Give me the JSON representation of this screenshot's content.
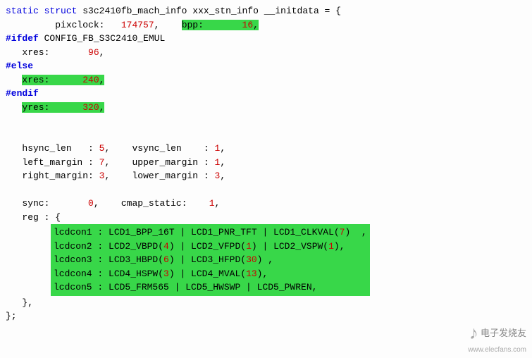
{
  "decl": {
    "static": "static",
    "struct": "struct",
    "type": "s3c2410fb_mach_info",
    "varname": "xxx_stn_info",
    "initdata": "__initdata",
    "eq": " = {"
  },
  "pixclock": {
    "label": "pixclock:",
    "value": "174757",
    "comma": ","
  },
  "bpp": {
    "label": "bpp:",
    "value": "16",
    "comma": ","
  },
  "ifdef": "#ifdef",
  "ifdef_sym": "CONFIG_FB_S3C2410_EMUL",
  "xres1": {
    "label": "xres:",
    "value": "96",
    "comma": ","
  },
  "else": "#else",
  "xres2": {
    "label": "xres:",
    "value": "240",
    "comma": ","
  },
  "endif": "#endif",
  "yres": {
    "label": "yres:",
    "value": "320",
    "comma": ","
  },
  "hsync": {
    "label": "hsync_len   : ",
    "value": "5",
    "comma": ","
  },
  "vsync": {
    "label": "vsync_len    : ",
    "value": "1",
    "comma": ","
  },
  "lmargin": {
    "label": "left_margin : ",
    "value": "7",
    "comma": ","
  },
  "umargin": {
    "label": "upper_margin : ",
    "value": "1",
    "comma": ","
  },
  "rmargin": {
    "label": "right_margin: ",
    "value": "3",
    "comma": ","
  },
  "lomargin": {
    "label": "lower_margin : ",
    "value": "3",
    "comma": ","
  },
  "sync": {
    "label": "sync:       ",
    "value": "0",
    "comma": ","
  },
  "cmap": {
    "label": "cmap_static:    ",
    "value": "1",
    "comma": ","
  },
  "reg": {
    "label": "reg : {"
  },
  "lcdcon1": {
    "label": "lcdcon1 : LCD1_BPP_16T | LCD1_PNR_TFT | LCD1_CLKVAL(",
    "v": "7",
    "rest": ")  ,"
  },
  "lcdcon2": {
    "label": "lcdcon2 : LCD2_VBPD(",
    "v1": "4",
    "mid1": ") | LCD2_VFPD(",
    "v2": "1",
    "mid2": ") | LCD2_VSPW(",
    "v3": "1",
    "rest": "),"
  },
  "lcdcon3": {
    "label": "lcdcon3 : LCD3_HBPD(",
    "v1": "6",
    "mid1": ") | LCD3_HFPD(",
    "v2": "30",
    "rest": ") ,"
  },
  "lcdcon4": {
    "label": "lcdcon4 : LCD4_HSPW(",
    "v1": "3",
    "mid1": ") | LCD4_MVAL(",
    "v2": "13",
    "rest": "),"
  },
  "lcdcon5": {
    "label": "lcdcon5 : LCD5_FRM565 | LCD5_HWSWP | LCD5_PWREN,"
  },
  "brace_close": "},",
  "end": "};",
  "watermark": {
    "cn": "电子发烧友",
    "url": "www.elecfans.com"
  }
}
